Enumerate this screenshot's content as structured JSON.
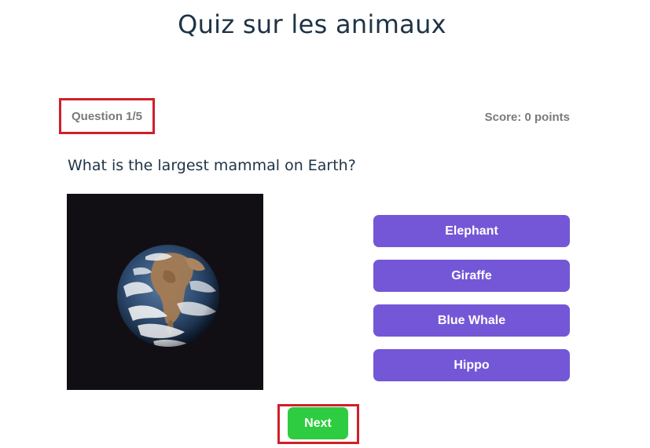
{
  "quiz": {
    "title": "Quiz sur les animaux",
    "question_counter": "Question 1/5",
    "score": "Score: 0 points",
    "question": "What is the largest mammal on Earth?",
    "image": {
      "subject": "earth-globe-image"
    },
    "answers": [
      {
        "label": "Elephant"
      },
      {
        "label": "Giraffe"
      },
      {
        "label": "Blue Whale"
      },
      {
        "label": "Hippo"
      }
    ],
    "next_label": "Next"
  },
  "colors": {
    "answer_button": "#7457d6",
    "next_button": "#2ecc40",
    "highlight_box": "#d0202a",
    "title_text": "#1f3346",
    "muted_text": "#7a7a7a"
  }
}
